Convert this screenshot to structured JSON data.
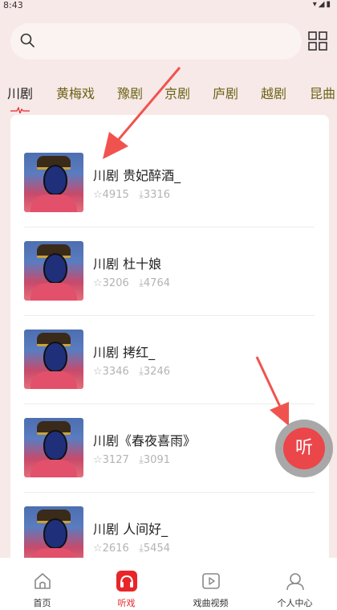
{
  "status_bar": {
    "time": "8:43",
    "icons": "▾◢▮"
  },
  "search": {
    "placeholder": ""
  },
  "tabs": [
    {
      "label": "川剧",
      "active": true
    },
    {
      "label": "黄梅戏"
    },
    {
      "label": "豫剧"
    },
    {
      "label": "京剧"
    },
    {
      "label": "庐剧"
    },
    {
      "label": "越剧"
    },
    {
      "label": "昆曲"
    }
  ],
  "list": [
    {
      "title": "川剧 贵妃醉酒_",
      "favorites": "4915",
      "downloads": "3316"
    },
    {
      "title": "川剧 杜十娘",
      "favorites": "3206",
      "downloads": "4764"
    },
    {
      "title": "川剧 拷红_",
      "favorites": "3346",
      "downloads": "3246"
    },
    {
      "title": "川剧《春夜喜雨》",
      "favorites": "3127",
      "downloads": "3091"
    },
    {
      "title": "川剧 人间好_",
      "favorites": "2616",
      "downloads": "5454"
    }
  ],
  "float_button": {
    "label": "听"
  },
  "bottom_nav": [
    {
      "label": "首页",
      "icon": "home-icon"
    },
    {
      "label": "听戏",
      "icon": "headphones-icon",
      "active": true
    },
    {
      "label": "戏曲视频",
      "icon": "video-icon"
    },
    {
      "label": "个人中心",
      "icon": "user-icon"
    }
  ],
  "colors": {
    "accent": "#e8262a",
    "tab_text": "#6d6317",
    "background": "#f7e9e8"
  }
}
